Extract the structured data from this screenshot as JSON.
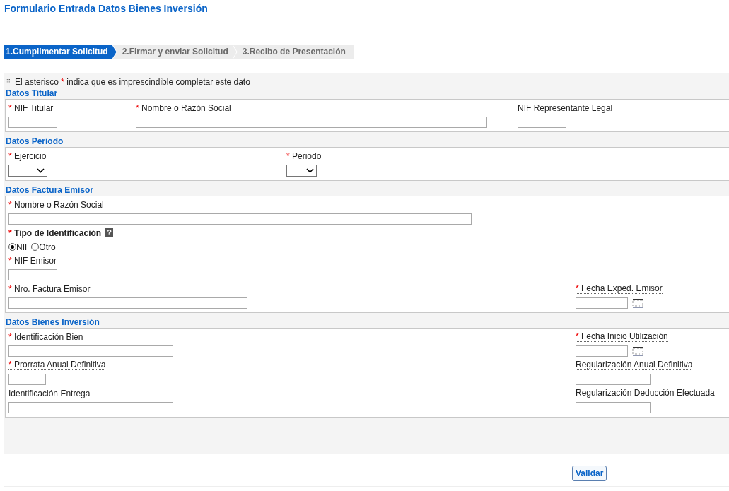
{
  "page_title": "Formulario Entrada Datos Bienes Inversión",
  "steps": [
    {
      "label": "1.Cumplimentar Solicitud",
      "selected": true
    },
    {
      "label": "2.Firmar y enviar Solicitud",
      "selected": false
    },
    {
      "label": "3.Recibo de Presentación",
      "selected": false
    }
  ],
  "note": {
    "before": "El asterisco",
    "mark": "*",
    "after": "indica que es imprescindible completar este dato"
  },
  "sections": [
    {
      "title": "Datos Titular",
      "rows": [
        [
          {
            "label": "NIF Titular",
            "required": true,
            "kind": "text"
          },
          {
            "label": "Nombre o Razón Social",
            "required": true,
            "kind": "text"
          },
          {
            "label": "NIF Representante Legal",
            "required": false,
            "kind": "text"
          }
        ]
      ]
    },
    {
      "title": "Datos Periodo",
      "rows": [
        [
          {
            "label": "Ejercicio",
            "required": true,
            "kind": "select"
          },
          {
            "label": "Periodo",
            "required": true,
            "kind": "select"
          }
        ]
      ]
    },
    {
      "title": "Datos Factura Emisor",
      "rows": [
        [
          {
            "label": "Nombre o Razón Social",
            "required": true,
            "kind": "text"
          }
        ],
        [
          {
            "label": "Tipo de Identificación",
            "required": true,
            "kind": "radio",
            "emphasized": true,
            "help": "?",
            "options": [
              {
                "label": "NIF",
                "selected": true
              },
              {
                "label": "Otro",
                "selected": false
              }
            ]
          }
        ],
        [
          {
            "label": "NIF Emisor",
            "required": true,
            "kind": "text"
          }
        ],
        [
          {
            "label": "Nro. Factura Emisor",
            "required": true,
            "kind": "text"
          },
          {
            "label": "Fecha Exped. Emisor",
            "required": true,
            "kind": "date",
            "hint": true
          }
        ]
      ]
    },
    {
      "title": "Datos Bienes Inversión",
      "rows": [
        [
          {
            "label": "Identificación Bien",
            "required": true,
            "kind": "text"
          },
          {
            "label": "Fecha Inicio Utilización",
            "required": true,
            "kind": "date",
            "hint": true
          }
        ],
        [
          {
            "label": "Prorrata Anual Definitiva",
            "required": true,
            "kind": "text",
            "hint": true
          },
          {
            "label": "Regularización Anual Definitiva",
            "required": false,
            "kind": "text",
            "hint": true
          }
        ],
        [
          {
            "label": "Identificación Entrega",
            "required": false,
            "kind": "text"
          },
          {
            "label": "Regularización Deducción Efectuada",
            "required": false,
            "kind": "text",
            "hint": true
          }
        ]
      ]
    }
  ],
  "validate_button": "Validar"
}
